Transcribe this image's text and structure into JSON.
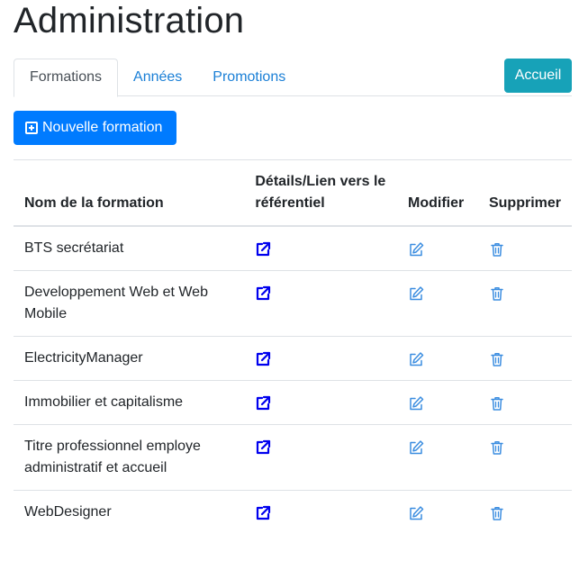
{
  "page": {
    "title": "Administration"
  },
  "tabs": [
    {
      "label": "Formations",
      "active": true
    },
    {
      "label": "Années",
      "active": false
    },
    {
      "label": "Promotions",
      "active": false
    }
  ],
  "accueil_label": "Accueil",
  "new_formation_label": "Nouvelle formation",
  "table": {
    "headers": {
      "name": "Nom de la formation",
      "details": "Détails/Lien vers le référentiel",
      "modify": "Modifier",
      "delete": "Supprimer"
    },
    "rows": [
      {
        "name": "BTS secrétariat"
      },
      {
        "name": "Developpement Web et Web Mobile"
      },
      {
        "name": "ElectricityManager"
      },
      {
        "name": "Immobilier et capitalisme"
      },
      {
        "name": "Titre professionnel employe administratif et accueil"
      },
      {
        "name": "WebDesigner"
      }
    ]
  },
  "icons": {
    "details": "external-link-icon",
    "modify": "edit-icon",
    "delete": "trash-icon"
  },
  "colors": {
    "link": "#1a7fd6",
    "primary": "#007bff",
    "info": "#17a2b8",
    "external_link_icon": "#0000ee",
    "action_icon": "#3b8de0"
  }
}
